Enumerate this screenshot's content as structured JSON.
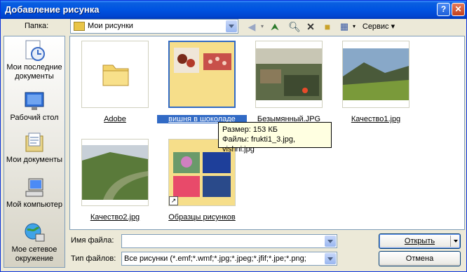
{
  "window": {
    "title": "Добавление рисунка"
  },
  "toolbar": {
    "folder_label": "Папка:",
    "current_folder": "Мои рисунки",
    "service_label": "Сервис"
  },
  "places": [
    {
      "label": "Мои последние документы",
      "icon": "recent-docs-icon"
    },
    {
      "label": "Рабочий стол",
      "icon": "desktop-icon"
    },
    {
      "label": "Мои документы",
      "icon": "my-documents-icon"
    },
    {
      "label": "Мой компьютер",
      "icon": "my-computer-icon"
    },
    {
      "label": "Мое сетевое окружение",
      "icon": "network-icon"
    }
  ],
  "files": [
    {
      "name": "Adobe",
      "kind": "folder"
    },
    {
      "name": "вишня в шоколаде",
      "kind": "folder-thumbs",
      "selected": true
    },
    {
      "name": "Безымянный.JPG",
      "kind": "image"
    },
    {
      "name": "Качество1.jpg",
      "kind": "image"
    },
    {
      "name": "Качество2.jpg",
      "kind": "image"
    },
    {
      "name": "Образцы рисунков",
      "kind": "folder-thumbs"
    }
  ],
  "tooltip": {
    "line1": "Размер: 153 КБ",
    "line2": "Файлы: frukti1_3.jpg, vishni.jpg"
  },
  "bottom": {
    "filename_label": "Имя файла:",
    "filename_value": "",
    "filetype_label": "Тип файлов:",
    "filetype_value": "Все рисунки (*.emf;*.wmf;*.jpg;*.jpeg;*.jfif;*.jpe;*.png;",
    "open_label": "Открыть",
    "cancel_label": "Отмена"
  }
}
